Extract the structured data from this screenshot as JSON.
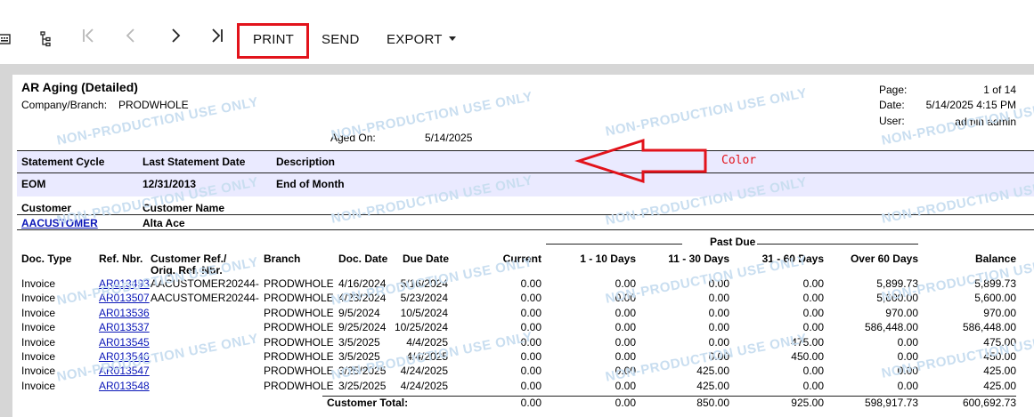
{
  "toolbar": {
    "print": "PRINT",
    "send": "SEND",
    "export": "EXPORT",
    "colors": {
      "highlight": "#e2131b"
    }
  },
  "report": {
    "title": "AR Aging (Detailed)",
    "company_label": "Company/Branch:",
    "company_value": "PRODWHOLE",
    "page_label": "Page:",
    "page_value": "1 of 14",
    "date_label": "Date:",
    "date_value": "5/14/2025 4:15 PM",
    "user_label": "User:",
    "user_value": "admin admin",
    "aged_on_label": "Aged On:",
    "aged_on_value": "5/14/2025",
    "watermark": "NON-PRODUCTION USE ONLY"
  },
  "statement": {
    "h_cycle": "Statement Cycle",
    "h_last": "Last Statement Date",
    "h_desc": "Description",
    "cycle": "EOM",
    "last": "12/31/2013",
    "desc": "End of Month"
  },
  "customer": {
    "h_customer": "Customer",
    "h_name": "Customer Name",
    "id": "AACUSTOMER",
    "name": "Alta Ace"
  },
  "table": {
    "past_due": "Past Due",
    "headers": {
      "doc_type": "Doc. Type",
      "ref": "Ref. Nbr.",
      "cust_ref": "Customer Ref./",
      "orig_ref": "Orig. Ref. Nbr.",
      "branch": "Branch",
      "doc_date": "Doc. Date",
      "due_date": "Due Date",
      "current": "Current",
      "d1_10": "1 - 10 Days",
      "d11_30": "11 - 30 Days",
      "d31_60": "31 - 60 Days",
      "over60": "Over 60 Days",
      "balance": "Balance"
    },
    "rows": [
      [
        "Invoice",
        "AR013493",
        "AACUSTOMER20244-",
        "PRODWHOLE",
        "4/16/2024",
        "5/16/2024",
        "0.00",
        "0.00",
        "0.00",
        "0.00",
        "5,899.73",
        "5,899.73"
      ],
      [
        "Invoice",
        "AR013507",
        "AACUSTOMER20244-",
        "PRODWHOLE",
        "4/23/2024",
        "5/23/2024",
        "0.00",
        "0.00",
        "0.00",
        "0.00",
        "5,600.00",
        "5,600.00"
      ],
      [
        "Invoice",
        "AR013536",
        "",
        "PRODWHOLE",
        "9/5/2024",
        "10/5/2024",
        "0.00",
        "0.00",
        "0.00",
        "0.00",
        "970.00",
        "970.00"
      ],
      [
        "Invoice",
        "AR013537",
        "",
        "PRODWHOLE",
        "9/25/2024",
        "10/25/2024",
        "0.00",
        "0.00",
        "0.00",
        "0.00",
        "586,448.00",
        "586,448.00"
      ],
      [
        "Invoice",
        "AR013545",
        "",
        "PRODWHOLE",
        "3/5/2025",
        "4/4/2025",
        "0.00",
        "0.00",
        "0.00",
        "475.00",
        "0.00",
        "475.00"
      ],
      [
        "Invoice",
        "AR013546",
        "",
        "PRODWHOLE",
        "3/5/2025",
        "4/4/2025",
        "0.00",
        "0.00",
        "0.00",
        "450.00",
        "0.00",
        "450.00"
      ],
      [
        "Invoice",
        "AR013547",
        "",
        "PRODWHOLE",
        "3/25/2025",
        "4/24/2025",
        "0.00",
        "0.00",
        "425.00",
        "0.00",
        "0.00",
        "425.00"
      ],
      [
        "Invoice",
        "AR013548",
        "",
        "PRODWHOLE",
        "3/25/2025",
        "4/24/2025",
        "0.00",
        "0.00",
        "425.00",
        "0.00",
        "0.00",
        "425.00"
      ]
    ],
    "total_label": "Customer Total:",
    "totals": [
      "0.00",
      "0.00",
      "850.00",
      "925.00",
      "598,917.73",
      "600,692.73"
    ]
  },
  "annotation": {
    "label": "Color"
  }
}
